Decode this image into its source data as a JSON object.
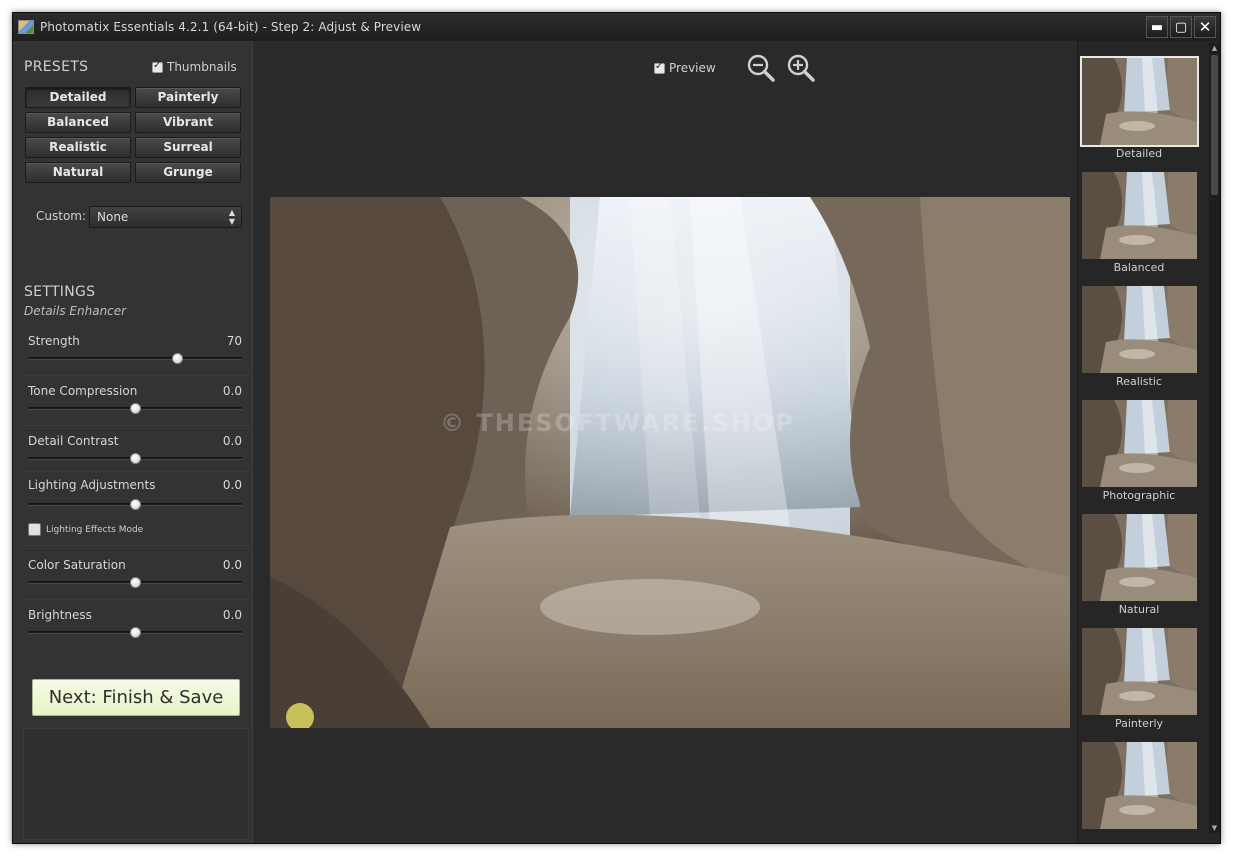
{
  "window": {
    "title": "Photomatix Essentials 4.2.1 (64-bit) - Step 2: Adjust & Preview",
    "controls": {
      "minimize": "▬",
      "maximize": "▢",
      "close": "✕"
    }
  },
  "presets": {
    "title": "PRESETS",
    "thumbnails_label": "Thumbnails",
    "thumbnails_checked": true,
    "buttons": [
      "Detailed",
      "Painterly",
      "Balanced",
      "Vibrant",
      "Realistic",
      "Surreal",
      "Natural",
      "Grunge"
    ],
    "active": "Detailed",
    "custom_label": "Custom:",
    "custom_value": "None"
  },
  "settings": {
    "title": "SETTINGS",
    "subtitle": "Details Enhancer",
    "sliders": [
      {
        "label": "Strength",
        "value": "70",
        "level": 0.7
      },
      {
        "label": "Tone Compression",
        "value": "0.0",
        "level": 0.5
      },
      {
        "label": "Detail Contrast",
        "value": "0.0",
        "level": 0.5
      },
      {
        "label": "Lighting Adjustments",
        "value": "0.0",
        "level": 0.5
      },
      {
        "label": "Color Saturation",
        "value": "0.0",
        "level": 0.5
      },
      {
        "label": "Brightness",
        "value": "0.0",
        "level": 0.5
      }
    ],
    "lighting_mode_label": "Lighting Effects Mode",
    "lighting_mode_checked": false
  },
  "next_button": "Next: Finish & Save",
  "preview": {
    "label": "Preview",
    "checked": true,
    "watermark": "© THESOFTWARE.SHOP"
  },
  "thumbnails": [
    "Detailed",
    "Balanced",
    "Realistic",
    "Photographic",
    "Natural",
    "Painterly",
    ""
  ],
  "selected_thumbnail": "Detailed",
  "icons": [
    "app-icon",
    "zoom-out-icon",
    "zoom-in-icon",
    "checkbox-icon",
    "chevron-updown-icon"
  ]
}
